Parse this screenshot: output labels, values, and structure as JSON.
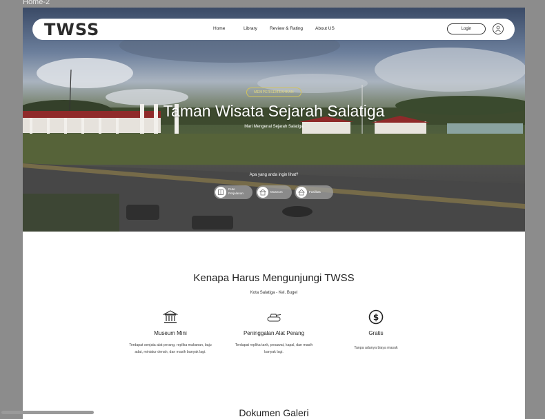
{
  "frame_label": "Home-2",
  "nav": {
    "logo": "TWSS",
    "links": [
      "Home",
      "Library",
      "Review & Rating",
      "About US"
    ],
    "login": "Login"
  },
  "hero": {
    "badge": "MEMPERSEMBAHKAN",
    "title": "Taman Wisata Sejarah Salatiga",
    "subtitle": "Mari Mengenal Sejarah Salatiga",
    "question": "Apa yang anda ingin lihat?",
    "chips": [
      {
        "label_l1": "Rute",
        "label_l2": "Perjalanan",
        "icon": "map-icon"
      },
      {
        "label_l1": "Museum",
        "label_l2": "",
        "icon": "museum-icon"
      },
      {
        "label_l1": "Fasilitas",
        "label_l2": "",
        "icon": "facility-icon"
      }
    ]
  },
  "why": {
    "title": "Kenapa Harus Mengunjungi TWSS",
    "subtitle": "Kota Salatiga - Kel. Bugel",
    "features": [
      {
        "title": "Museum Mini",
        "desc_l1": "Terdapat senjata alat perang, replika makanan, baju",
        "desc_l2": "adat, miniatur denah, dan masih banyak lagi.",
        "icon": "museum-icon"
      },
      {
        "title": "Peninggalan Alat Perang",
        "desc_l1": "Terdapat replika tank, pesawat, kapal, dan masih",
        "desc_l2": "banyak lagi.",
        "icon": "tank-icon"
      },
      {
        "title": "Gratis",
        "desc_l1": "Tanpa adanya biaya masuk",
        "desc_l2": "",
        "icon": "dollar-icon"
      }
    ]
  },
  "gallery": {
    "title": "Dokumen Galeri"
  }
}
